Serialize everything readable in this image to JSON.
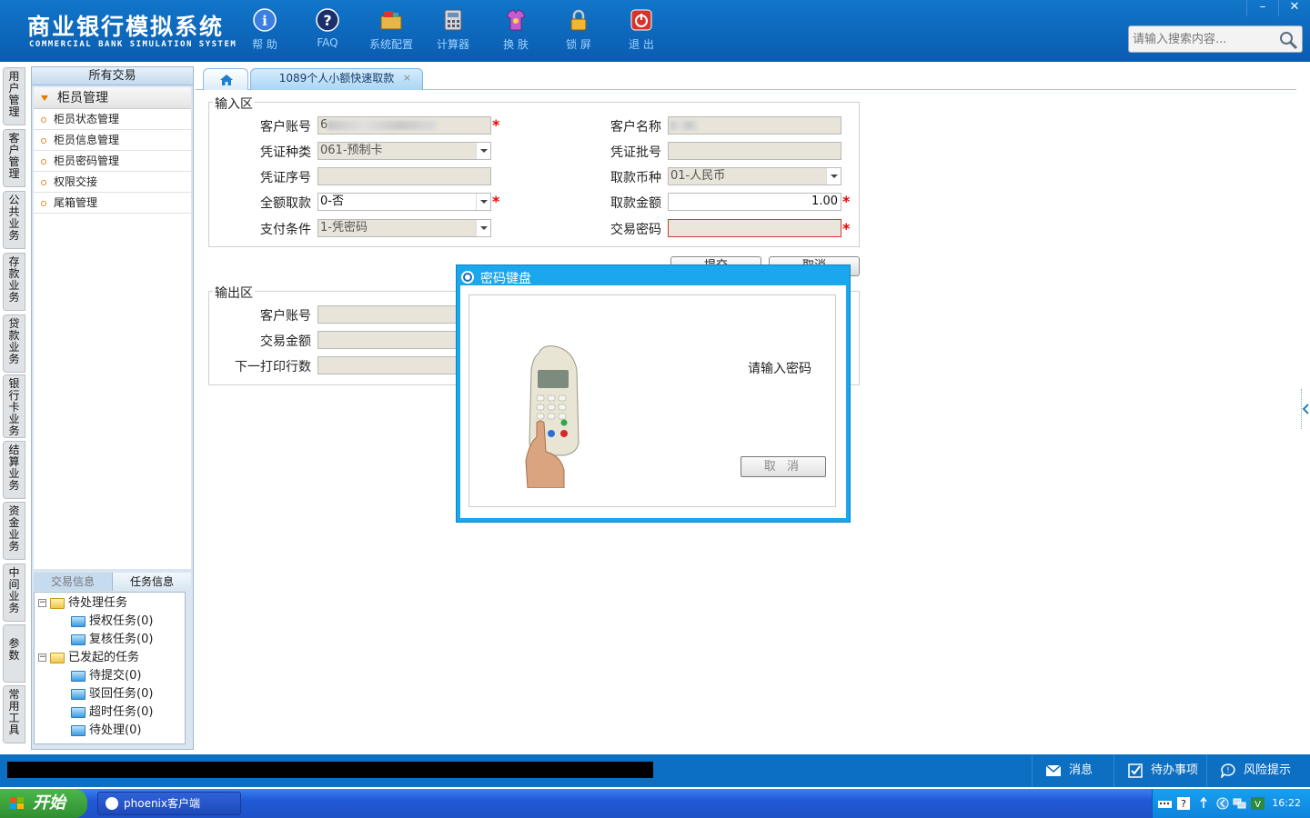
{
  "header": {
    "logo_cn": "商业银行模拟系统",
    "logo_en": "COMMERCIAL BANK SIMULATION SYSTEM",
    "toolbar": [
      {
        "label": "帮 助",
        "icon": "help-icon"
      },
      {
        "label": "FAQ",
        "icon": "faq-icon"
      },
      {
        "label": "系统配置",
        "icon": "system-config-icon"
      },
      {
        "label": "计算器",
        "icon": "calculator-icon"
      },
      {
        "label": "换 肤",
        "icon": "skin-icon"
      },
      {
        "label": "锁 屏",
        "icon": "lock-icon"
      },
      {
        "label": "退 出",
        "icon": "exit-icon"
      }
    ],
    "window_controls": {
      "minimize": "–",
      "close": "✕"
    },
    "search_placeholder": "请输入搜索内容..."
  },
  "vnav": [
    "用户管理",
    "客户管理",
    "公共业务",
    "存款业务",
    "贷款业务",
    "银行卡业务",
    "结算业务",
    "资金业务",
    "中间业务",
    "参数",
    "常用工具"
  ],
  "sidebar": {
    "header": "所有交易",
    "group": "柜员管理",
    "items": [
      "柜员状态管理",
      "柜员信息管理",
      "柜员密码管理",
      "权限交接",
      "尾箱管理"
    ],
    "tabs": [
      "交易信息",
      "任务信息"
    ],
    "tree": {
      "pending": "待处理任务",
      "pending_children": [
        "授权任务(0)",
        "复核任务(0)"
      ],
      "initiated": "已发起的任务",
      "initiated_children": [
        "待提交(0)",
        "驳回任务(0)",
        "超时任务(0)",
        "待处理(0)"
      ]
    }
  },
  "tabs": {
    "active": "1089个人小额快速取款",
    "close": "×"
  },
  "form": {
    "input_legend": "输入区",
    "output_legend": "输出区",
    "labels": {
      "account": "客户账号",
      "name": "客户名称",
      "voucher_type": "凭证种类",
      "voucher_batch": "凭证批号",
      "voucher_no": "凭证序号",
      "currency": "取款币种",
      "full_withdraw": "全额取款",
      "amount": "取款金额",
      "pay_cond": "支付条件",
      "password": "交易密码",
      "out_account": "客户账号",
      "out_amount": "交易金额",
      "out_print": "下一打印行数"
    },
    "values": {
      "account_prefix": "6",
      "voucher_type": "061-预制卡",
      "currency": "01-人民币",
      "full_withdraw": "0-否",
      "amount": "1.00",
      "pay_cond": "1-凭密码"
    },
    "required_mark": "*",
    "submit": "提交",
    "cancel": "取消"
  },
  "modal": {
    "title": "密码键盘",
    "prompt": "请输入密码",
    "cancel": "取 消"
  },
  "statusbar": {
    "messages": "消息",
    "todo": "待办事项",
    "risk": "风险提示"
  },
  "taskbar": {
    "start": "开始",
    "app": "phoenix客户端",
    "clock": "16:22"
  }
}
